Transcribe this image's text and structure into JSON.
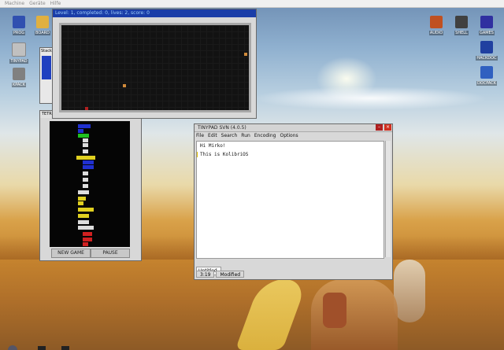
{
  "host_menu": [
    "Machine",
    "Geräte",
    "Hilfe"
  ],
  "desktop_icons_left": [
    {
      "label": "PROG",
      "color": "#3050b0"
    },
    {
      "label": "BOARD",
      "color": "#e0b040"
    },
    {
      "label": "TINYPAD",
      "color": "#c0c0c0"
    },
    {
      "label": "KPACK",
      "color": "#808080"
    }
  ],
  "desktop_icons_right": [
    {
      "label": "AUDIO",
      "color": "#c05020"
    },
    {
      "label": "SHELL",
      "color": "#404040"
    },
    {
      "label": "GAMES",
      "color": "#3030a0"
    },
    {
      "label": "HACKDOC",
      "color": "#2040a0"
    },
    {
      "label": "DOCPACK",
      "color": "#3060c0"
    }
  ],
  "snake": {
    "title": "Level: 1, completed: 0, lives: 2, score: 0"
  },
  "stack_window": {
    "label": "Stack"
  },
  "tetris": {
    "tab_label": "TETRIS",
    "new_game": "NEW GAME",
    "pause": "PAUSE"
  },
  "tinypad": {
    "title": "TINYPAD SVN (4.0.5)",
    "menu": [
      "File",
      "Edit",
      "Search",
      "Run",
      "Encoding",
      "Options"
    ],
    "lines": [
      "Hi Mirko!",
      "This is KolibriOS"
    ],
    "tab": "Untitled",
    "status_position": "3:19",
    "status_state": "Modified"
  }
}
